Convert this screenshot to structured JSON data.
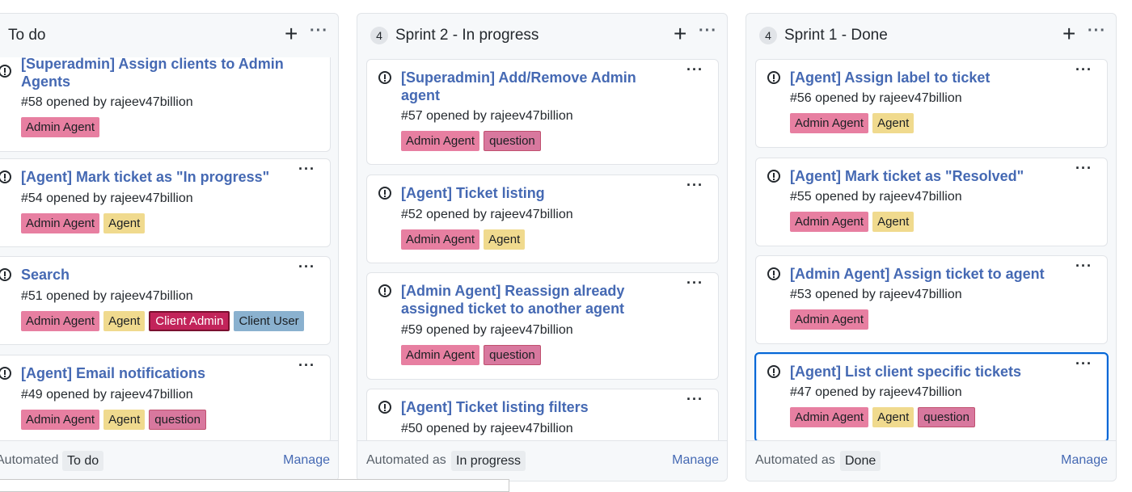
{
  "columns": [
    {
      "title": "To do",
      "count": "",
      "automation": {
        "prefix": "Automated as",
        "state": "To do",
        "manage": "Manage"
      },
      "cards": [
        {
          "title": "[Superadmin] Assign clients to Admin Agents",
          "meta": "#58 opened by rajeev47billion",
          "labels": [
            "Admin Agent"
          ]
        },
        {
          "title": "[Agent] Mark ticket as \"In progress\"",
          "meta": "#54 opened by rajeev47billion",
          "labels": [
            "Admin Agent",
            "Agent"
          ]
        },
        {
          "title": "Search",
          "meta": "#51 opened by rajeev47billion",
          "labels": [
            "Admin Agent",
            "Agent",
            "Client Admin",
            "Client User"
          ]
        },
        {
          "title": "[Agent] Email notifications",
          "meta": "#49 opened by rajeev47billion",
          "labels": [
            "Admin Agent",
            "Agent",
            "question"
          ]
        }
      ]
    },
    {
      "title": "Sprint 2 - In progress",
      "count": "4",
      "automation": {
        "prefix": "Automated as",
        "state": "In progress",
        "manage": "Manage"
      },
      "cards": [
        {
          "title": "[Superadmin] Add/Remove Admin agent",
          "meta": "#57 opened by rajeev47billion",
          "labels": [
            "Admin Agent",
            "question"
          ]
        },
        {
          "title": "[Agent] Ticket listing",
          "meta": "#52 opened by rajeev47billion",
          "labels": [
            "Admin Agent",
            "Agent"
          ]
        },
        {
          "title": "[Admin Agent] Reassign already assigned ticket to another agent",
          "meta": "#59 opened by rajeev47billion",
          "labels": [
            "Admin Agent",
            "question"
          ]
        },
        {
          "title": "[Agent] Ticket listing filters",
          "meta": "#50 opened by rajeev47billion",
          "labels": []
        }
      ]
    },
    {
      "title": "Sprint 1 - Done",
      "count": "4",
      "automation": {
        "prefix": "Automated as",
        "state": "Done",
        "manage": "Manage"
      },
      "cards": [
        {
          "title": "[Agent] Assign label to ticket",
          "meta": "#56 opened by rajeev47billion",
          "labels": [
            "Admin Agent",
            "Agent"
          ]
        },
        {
          "title": "[Agent] Mark ticket as \"Resolved\"",
          "meta": "#55 opened by rajeev47billion",
          "labels": [
            "Admin Agent",
            "Agent"
          ]
        },
        {
          "title": "[Admin Agent] Assign ticket to agent",
          "meta": "#53 opened by rajeev47billion",
          "labels": [
            "Admin Agent"
          ]
        },
        {
          "title": "[Agent] List client specific tickets",
          "meta": "#47 opened by rajeev47billion",
          "labels": [
            "Admin Agent",
            "Agent",
            "question"
          ]
        }
      ]
    }
  ],
  "icons": {
    "add": "plus-icon",
    "more": "kebab-icon",
    "issue": "issue-opened-icon"
  },
  "colors": {
    "link": "#4569b3",
    "admin_agent": "#e77fa1",
    "agent": "#f0da8e",
    "question": "#d8789e",
    "client_admin": "#c2245a",
    "client_user": "#8ab1cf",
    "selected_border": "#0366d6"
  }
}
